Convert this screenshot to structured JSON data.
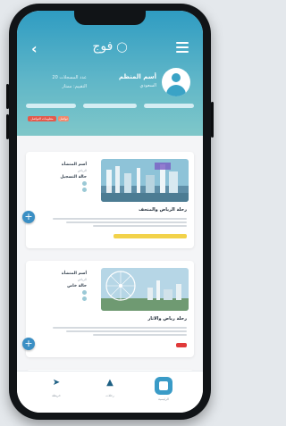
{
  "header": {
    "logo_text": "فوج",
    "user_name": "أسم المنظم",
    "user_role": "السعودي",
    "stats": [
      "عدد المسجلات 20",
      "التقييم: ممتاز"
    ],
    "tags": [
      {
        "label": "معلومات التواصل",
        "color": "#e45a4c"
      },
      {
        "label": "تواصل",
        "color": "#f08a6e"
      }
    ]
  },
  "trips": [
    {
      "title": "رحلة الرياض والمتحف",
      "meta_title": "أسم المنشأة",
      "meta_subtitle": "الرياض",
      "meta_strong": "حالة التسجيل",
      "badge": "",
      "badge_color": "#f2d24a"
    },
    {
      "title": "رحلة رياض والاثار",
      "meta_title": "أسم المنشأة",
      "meta_subtitle": "الرياض",
      "meta_strong": "حالة خاص",
      "badge": "",
      "badge_color": "#e03a3a"
    }
  ],
  "nav": {
    "items": [
      {
        "label": "الرئيسية",
        "icon": "home-icon"
      },
      {
        "label": "رحلات",
        "icon": "graduation-cap-icon"
      },
      {
        "label": "خريطة",
        "icon": "location-arrow-icon"
      }
    ]
  },
  "colors": {
    "header_top": "#2f9cc2",
    "header_bottom": "#7fc7c9",
    "accent": "#3b8fc4"
  }
}
